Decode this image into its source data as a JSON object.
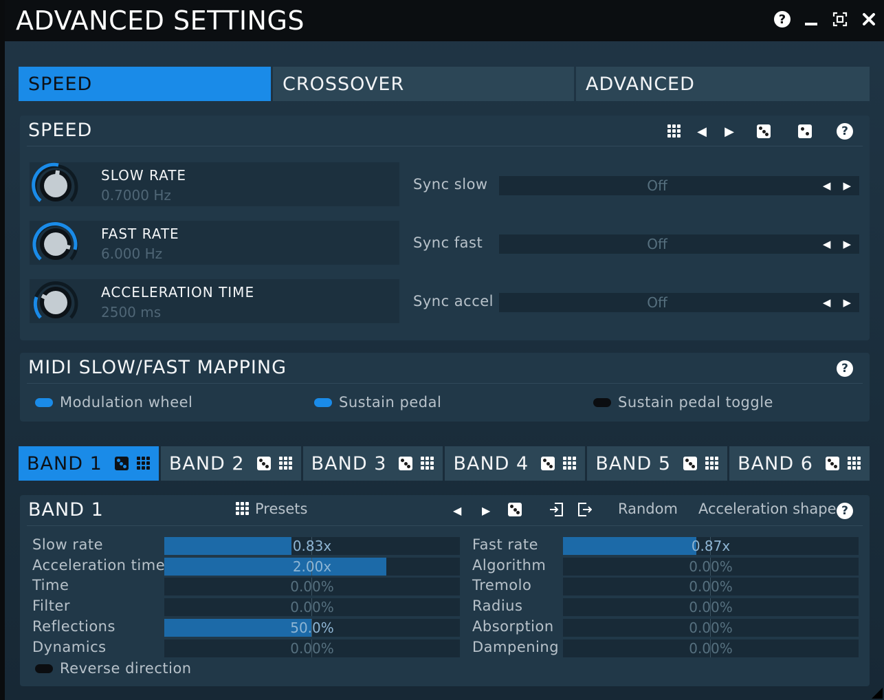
{
  "window": {
    "title": "ADVANCED SETTINGS"
  },
  "tabs": [
    {
      "label": "SPEED",
      "active": true
    },
    {
      "label": "CROSSOVER",
      "active": false
    },
    {
      "label": "ADVANCED",
      "active": false
    }
  ],
  "speed_panel": {
    "title": "SPEED",
    "knobs": [
      {
        "label": "SLOW RATE",
        "value": "0.7000 Hz"
      },
      {
        "label": "FAST RATE",
        "value": "6.000 Hz"
      },
      {
        "label": "ACCELERATION TIME",
        "value": "2500 ms"
      }
    ],
    "syncs": [
      {
        "label": "Sync slow",
        "value": "Off"
      },
      {
        "label": "Sync fast",
        "value": "Off"
      },
      {
        "label": "Sync accel",
        "value": "Off"
      }
    ]
  },
  "midi_panel": {
    "title": "MIDI SLOW/FAST MAPPING",
    "toggles": [
      {
        "label": "Modulation wheel",
        "on": true
      },
      {
        "label": "Sustain pedal",
        "on": true
      },
      {
        "label": "Sustain pedal toggle",
        "on": false
      }
    ]
  },
  "band_tabs": [
    {
      "label": "BAND 1",
      "active": true
    },
    {
      "label": "BAND 2",
      "active": false
    },
    {
      "label": "BAND 3",
      "active": false
    },
    {
      "label": "BAND 4",
      "active": false
    },
    {
      "label": "BAND 5",
      "active": false
    },
    {
      "label": "BAND 6",
      "active": false
    }
  ],
  "band_panel": {
    "title": "BAND 1",
    "presets_label": "Presets",
    "random_label": "Random",
    "accel_shape_label": "Acceleration shape",
    "left_params": [
      {
        "label": "Slow rate",
        "value": "0.83x",
        "fill": 0.43
      },
      {
        "label": "Acceleration time",
        "value": "2.00x",
        "fill": 0.75
      },
      {
        "label": "Time",
        "value": "0.00%",
        "fill": 0
      },
      {
        "label": "Filter",
        "value": "0.00%",
        "fill": 0
      },
      {
        "label": "Reflections",
        "value": "50.0%",
        "fill": 0.5
      },
      {
        "label": "Dynamics",
        "value": "0.00%",
        "fill": 0
      }
    ],
    "right_params": [
      {
        "label": "Fast rate",
        "value": "0.87x",
        "fill": 0.45
      },
      {
        "label": "Algorithm",
        "value": "0.00%",
        "fill": 0
      },
      {
        "label": "Tremolo",
        "value": "0.00%",
        "fill": 0
      },
      {
        "label": "Radius",
        "value": "0.00%",
        "fill": 0
      },
      {
        "label": "Absorption",
        "value": "0.00%",
        "fill": 0
      },
      {
        "label": "Dampening",
        "value": "0.00%",
        "fill": 0
      }
    ],
    "reverse_label": "Reverse direction",
    "reverse_on": false
  },
  "colors": {
    "accent": "#1a8be8",
    "panel": "#213848",
    "bar_fill": "#1c6aa8"
  }
}
